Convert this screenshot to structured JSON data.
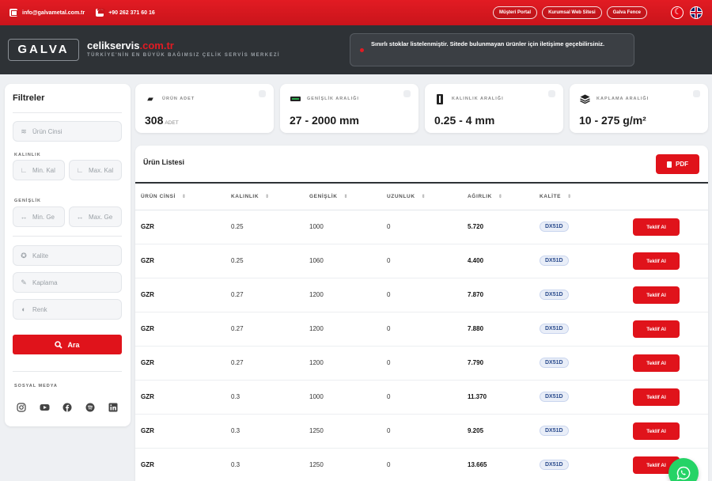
{
  "topbar": {
    "email": "info@galvametal.com.tr",
    "phone": "+90 262 371 60 16",
    "links": [
      "Müşteri Portal",
      "Kurumsal Web Sitesi",
      "Galva Fence"
    ]
  },
  "header": {
    "logo": "GALVA",
    "brand_main": "celikservis",
    "brand_tld": ".com.tr",
    "tagline": "TÜRKİYE'NİN EN BÜYÜK BAĞIMSIZ ÇELİK SERVİS MERKEZİ",
    "notice": "Sınırlı stoklar listelenmiştir. Sitede bulunmayan ürünler için iletişime geçebilirsiniz."
  },
  "filters": {
    "title": "Filtreler",
    "urun_cinsi_placeholder": "Ürün Cinsi",
    "kalinlik_label": "KALINLIK",
    "min_kal_placeholder": "Min. Kal",
    "max_kal_placeholder": "Max. Kal",
    "genislik_label": "GENİŞLİK",
    "min_gen_placeholder": "Min. Ge",
    "max_gen_placeholder": "Max. Ge",
    "kalite_placeholder": "Kalite",
    "kaplama_placeholder": "Kaplama",
    "renk_placeholder": "Renk",
    "search_label": "Ara",
    "social_label": "SOSYAL MEDYA"
  },
  "stats": [
    {
      "label": "ÜRÜN ADET",
      "value": "308",
      "unit": "ADET"
    },
    {
      "label": "GENİŞLİK ARALIĞI",
      "value": "27 - 2000 mm",
      "unit": ""
    },
    {
      "label": "KALINLIK ARALIĞI",
      "value": "0.25 - 4 mm",
      "unit": ""
    },
    {
      "label": "KAPLAMA ARALIĞI",
      "value": "10 - 275 g/m²",
      "unit": ""
    }
  ],
  "product_list": {
    "title": "Ürün Listesi",
    "pdf_label": "PDF",
    "columns": [
      "ÜRÜN CİNSİ",
      "KALINLIK",
      "GENİŞLİK",
      "UZUNLUK",
      "AĞIRLIK",
      "KALİTE"
    ],
    "action_label": "Teklif Al",
    "rows": [
      {
        "cinsi": "GZR",
        "kalinlik": "0.25",
        "genislik": "1000",
        "uzunluk": "0",
        "agirlik": "5.720",
        "kalite": "DX51D"
      },
      {
        "cinsi": "GZR",
        "kalinlik": "0.25",
        "genislik": "1060",
        "uzunluk": "0",
        "agirlik": "4.400",
        "kalite": "DX51D"
      },
      {
        "cinsi": "GZR",
        "kalinlik": "0.27",
        "genislik": "1200",
        "uzunluk": "0",
        "agirlik": "7.870",
        "kalite": "DX51D"
      },
      {
        "cinsi": "GZR",
        "kalinlik": "0.27",
        "genislik": "1200",
        "uzunluk": "0",
        "agirlik": "7.880",
        "kalite": "DX51D"
      },
      {
        "cinsi": "GZR",
        "kalinlik": "0.27",
        "genislik": "1200",
        "uzunluk": "0",
        "agirlik": "7.790",
        "kalite": "DX51D"
      },
      {
        "cinsi": "GZR",
        "kalinlik": "0.3",
        "genislik": "1000",
        "uzunluk": "0",
        "agirlik": "11.370",
        "kalite": "DX51D"
      },
      {
        "cinsi": "GZR",
        "kalinlik": "0.3",
        "genislik": "1250",
        "uzunluk": "0",
        "agirlik": "9.205",
        "kalite": "DX51D"
      },
      {
        "cinsi": "GZR",
        "kalinlik": "0.3",
        "genislik": "1250",
        "uzunluk": "0",
        "agirlik": "13.665",
        "kalite": "DX51D"
      }
    ]
  },
  "colors": {
    "brand_red": "#e0131b",
    "header_dark": "#2e3236",
    "whatsapp": "#25d366"
  },
  "icons": [
    "mail-icon",
    "phone-icon",
    "flag-tr-icon",
    "flag-uk-icon",
    "layers-icon",
    "ruler-icon",
    "width-icon",
    "star-icon",
    "brush-icon",
    "palette-icon",
    "search-icon",
    "instagram-icon",
    "youtube-icon",
    "facebook-icon",
    "spotify-icon",
    "linkedin-icon",
    "box-icon",
    "thickness-icon",
    "pdf-icon",
    "whatsapp-icon"
  ]
}
